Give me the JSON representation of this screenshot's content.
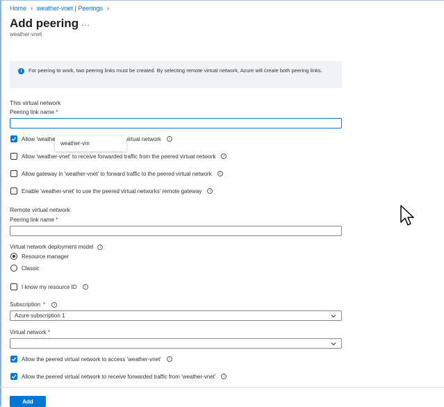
{
  "breadcrumb": {
    "items": [
      "Home",
      "weather-vnet | Peerings"
    ]
  },
  "header": {
    "title": "Add peering",
    "more": "...",
    "subtitle": "weather-vnet"
  },
  "info": {
    "text": "For peering to work, two peering links must be created. By selecting remote virtual network, Azure will create both peering links."
  },
  "this_vnet": {
    "section": "This virtual network",
    "link_label": "Peering link name",
    "link_value": "",
    "options": [
      {
        "label": "Allow 'weather-vnet' to access the peered virtual network",
        "checked": true
      },
      {
        "label": "Allow 'weather-vnet' to receive forwarded traffic from the peered virtual network",
        "checked": false
      },
      {
        "label": "Allow gateway in 'weather-vnet' to forward traffic to the peered virtual network",
        "checked": false
      },
      {
        "label": "Enable 'weather-vnet' to use the peered virtual networks' remote gateway",
        "checked": false
      }
    ]
  },
  "tooltip": {
    "text": "weather-vm"
  },
  "remote_vnet": {
    "section": "Remote virtual network",
    "link_label": "Peering link name",
    "link_value": "",
    "model_label": "Virtual network deployment model",
    "models": [
      {
        "label": "Resource manager",
        "selected": true
      },
      {
        "label": "Classic",
        "selected": false
      }
    ],
    "resource_id_label": "I know my resource ID",
    "subscription_label": "Subscription",
    "subscription_value": "Azure subscription 1",
    "vnet_label": "Virtual network",
    "vnet_value": "",
    "access_options": [
      {
        "label": "Allow the peered virtual network to access 'weather-vnet'",
        "checked": true
      },
      {
        "label": "Allow the peered virtual network to receive forwarded traffic from 'weather-vnet'",
        "checked": true
      }
    ]
  },
  "required_mark": "*",
  "footer": {
    "add_label": "Add"
  },
  "colors": {
    "accent": "#0078d4",
    "required": "#a4262c",
    "info_bg": "#eff2f7"
  },
  "icons": [
    "chevron-right-icon",
    "info-icon",
    "checkmark-icon",
    "chevron-down-icon",
    "cursor-icon"
  ]
}
